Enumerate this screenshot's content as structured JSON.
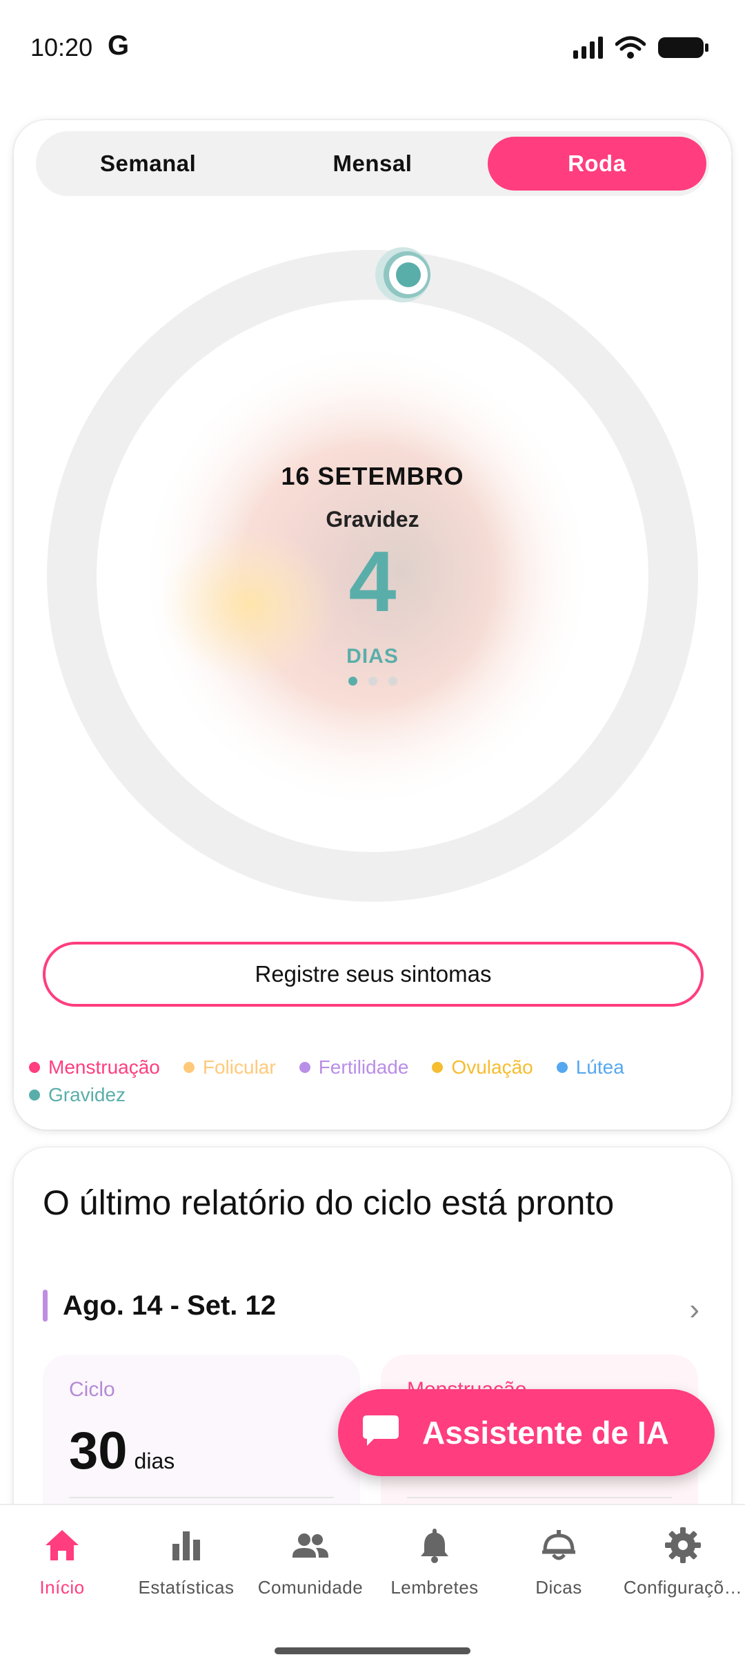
{
  "status_bar": {
    "time": "10:20",
    "carrier_icon": "G"
  },
  "wheel_card": {
    "tabs": [
      {
        "label": "Semanal",
        "active": false
      },
      {
        "label": "Mensal",
        "active": false
      },
      {
        "label": "Roda",
        "active": true
      }
    ],
    "center": {
      "date": "16 SETEMBRO",
      "phase": "Gravidez",
      "days": "4",
      "unit": "DIAS"
    },
    "page_dots": 3,
    "symptom_button": "Registre seus sintomas",
    "legend": [
      {
        "label": "Menstruação",
        "color": "#ff3d7f"
      },
      {
        "label": "Folicular",
        "color": "#ffc97a"
      },
      {
        "label": "Fertilidade",
        "color": "#b98ee6"
      },
      {
        "label": "Ovulação",
        "color": "#f5bd2f"
      },
      {
        "label": "Lútea",
        "color": "#55a8ef"
      },
      {
        "label": "Gravidez",
        "color": "#5aaeaa"
      }
    ]
  },
  "report_card": {
    "title": "O último relatório do ciclo está pronto",
    "range": "Ago. 14 - Set. 12",
    "stats": [
      {
        "label": "Ciclo",
        "value": "30",
        "unit": "dias"
      },
      {
        "label": "Menstruação",
        "value": "",
        "unit": ""
      }
    ]
  },
  "ai_button": {
    "label": "Assistente de IA"
  },
  "bottom_nav": [
    {
      "label": "Início",
      "icon": "home-icon",
      "active": true
    },
    {
      "label": "Estatísticas",
      "icon": "bar-chart-icon",
      "active": false
    },
    {
      "label": "Comunidade",
      "icon": "people-icon",
      "active": false
    },
    {
      "label": "Lembretes",
      "icon": "bell-icon",
      "active": false
    },
    {
      "label": "Dicas",
      "icon": "tips-icon",
      "active": false
    },
    {
      "label": "Configuraçõ…",
      "icon": "gear-icon",
      "active": false
    }
  ],
  "colors": {
    "accent": "#ff3d7f",
    "teal": "#5aaeaa",
    "purple": "#b98ee6"
  }
}
